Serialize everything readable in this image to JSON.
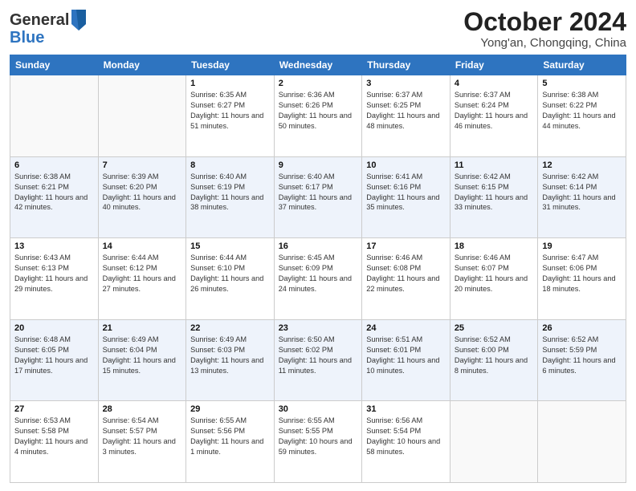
{
  "header": {
    "logo_line1": "General",
    "logo_line2": "Blue",
    "month_title": "October 2024",
    "location": "Yong'an, Chongqing, China"
  },
  "weekdays": [
    "Sunday",
    "Monday",
    "Tuesday",
    "Wednesday",
    "Thursday",
    "Friday",
    "Saturday"
  ],
  "weeks": [
    [
      {
        "day": "",
        "info": ""
      },
      {
        "day": "",
        "info": ""
      },
      {
        "day": "1",
        "info": "Sunrise: 6:35 AM\nSunset: 6:27 PM\nDaylight: 11 hours and 51 minutes."
      },
      {
        "day": "2",
        "info": "Sunrise: 6:36 AM\nSunset: 6:26 PM\nDaylight: 11 hours and 50 minutes."
      },
      {
        "day": "3",
        "info": "Sunrise: 6:37 AM\nSunset: 6:25 PM\nDaylight: 11 hours and 48 minutes."
      },
      {
        "day": "4",
        "info": "Sunrise: 6:37 AM\nSunset: 6:24 PM\nDaylight: 11 hours and 46 minutes."
      },
      {
        "day": "5",
        "info": "Sunrise: 6:38 AM\nSunset: 6:22 PM\nDaylight: 11 hours and 44 minutes."
      }
    ],
    [
      {
        "day": "6",
        "info": "Sunrise: 6:38 AM\nSunset: 6:21 PM\nDaylight: 11 hours and 42 minutes."
      },
      {
        "day": "7",
        "info": "Sunrise: 6:39 AM\nSunset: 6:20 PM\nDaylight: 11 hours and 40 minutes."
      },
      {
        "day": "8",
        "info": "Sunrise: 6:40 AM\nSunset: 6:19 PM\nDaylight: 11 hours and 38 minutes."
      },
      {
        "day": "9",
        "info": "Sunrise: 6:40 AM\nSunset: 6:17 PM\nDaylight: 11 hours and 37 minutes."
      },
      {
        "day": "10",
        "info": "Sunrise: 6:41 AM\nSunset: 6:16 PM\nDaylight: 11 hours and 35 minutes."
      },
      {
        "day": "11",
        "info": "Sunrise: 6:42 AM\nSunset: 6:15 PM\nDaylight: 11 hours and 33 minutes."
      },
      {
        "day": "12",
        "info": "Sunrise: 6:42 AM\nSunset: 6:14 PM\nDaylight: 11 hours and 31 minutes."
      }
    ],
    [
      {
        "day": "13",
        "info": "Sunrise: 6:43 AM\nSunset: 6:13 PM\nDaylight: 11 hours and 29 minutes."
      },
      {
        "day": "14",
        "info": "Sunrise: 6:44 AM\nSunset: 6:12 PM\nDaylight: 11 hours and 27 minutes."
      },
      {
        "day": "15",
        "info": "Sunrise: 6:44 AM\nSunset: 6:10 PM\nDaylight: 11 hours and 26 minutes."
      },
      {
        "day": "16",
        "info": "Sunrise: 6:45 AM\nSunset: 6:09 PM\nDaylight: 11 hours and 24 minutes."
      },
      {
        "day": "17",
        "info": "Sunrise: 6:46 AM\nSunset: 6:08 PM\nDaylight: 11 hours and 22 minutes."
      },
      {
        "day": "18",
        "info": "Sunrise: 6:46 AM\nSunset: 6:07 PM\nDaylight: 11 hours and 20 minutes."
      },
      {
        "day": "19",
        "info": "Sunrise: 6:47 AM\nSunset: 6:06 PM\nDaylight: 11 hours and 18 minutes."
      }
    ],
    [
      {
        "day": "20",
        "info": "Sunrise: 6:48 AM\nSunset: 6:05 PM\nDaylight: 11 hours and 17 minutes."
      },
      {
        "day": "21",
        "info": "Sunrise: 6:49 AM\nSunset: 6:04 PM\nDaylight: 11 hours and 15 minutes."
      },
      {
        "day": "22",
        "info": "Sunrise: 6:49 AM\nSunset: 6:03 PM\nDaylight: 11 hours and 13 minutes."
      },
      {
        "day": "23",
        "info": "Sunrise: 6:50 AM\nSunset: 6:02 PM\nDaylight: 11 hours and 11 minutes."
      },
      {
        "day": "24",
        "info": "Sunrise: 6:51 AM\nSunset: 6:01 PM\nDaylight: 11 hours and 10 minutes."
      },
      {
        "day": "25",
        "info": "Sunrise: 6:52 AM\nSunset: 6:00 PM\nDaylight: 11 hours and 8 minutes."
      },
      {
        "day": "26",
        "info": "Sunrise: 6:52 AM\nSunset: 5:59 PM\nDaylight: 11 hours and 6 minutes."
      }
    ],
    [
      {
        "day": "27",
        "info": "Sunrise: 6:53 AM\nSunset: 5:58 PM\nDaylight: 11 hours and 4 minutes."
      },
      {
        "day": "28",
        "info": "Sunrise: 6:54 AM\nSunset: 5:57 PM\nDaylight: 11 hours and 3 minutes."
      },
      {
        "day": "29",
        "info": "Sunrise: 6:55 AM\nSunset: 5:56 PM\nDaylight: 11 hours and 1 minute."
      },
      {
        "day": "30",
        "info": "Sunrise: 6:55 AM\nSunset: 5:55 PM\nDaylight: 10 hours and 59 minutes."
      },
      {
        "day": "31",
        "info": "Sunrise: 6:56 AM\nSunset: 5:54 PM\nDaylight: 10 hours and 58 minutes."
      },
      {
        "day": "",
        "info": ""
      },
      {
        "day": "",
        "info": ""
      }
    ]
  ]
}
